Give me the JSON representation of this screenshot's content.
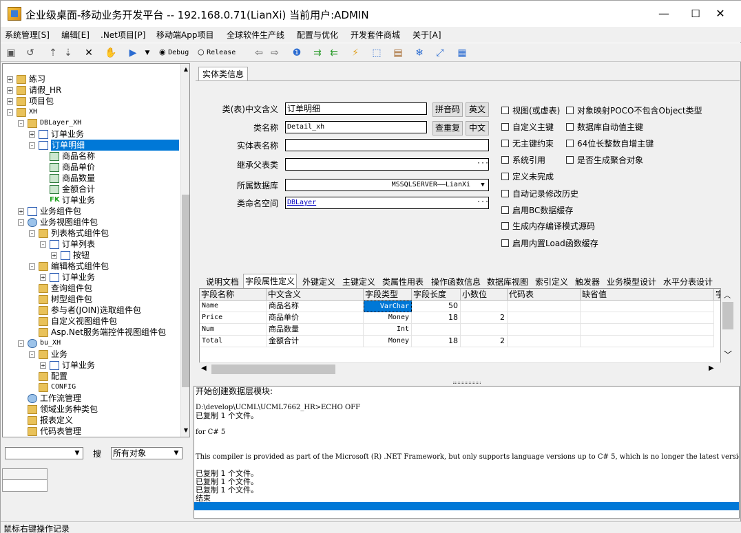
{
  "window": {
    "title": "企业级桌面-移动业务开发平台 -- 192.168.0.71(LianXi) 当前用户:ADMIN",
    "minimize": "—",
    "maximize": "☐",
    "close": "✕"
  },
  "menu": [
    "系统管理[S]",
    "编辑[E]",
    ".Net项目[P]",
    "移动端App项目",
    "全球软件生产线",
    "配置与优化",
    "开发套件商城",
    "关于[A]"
  ],
  "toolbar": {
    "debug_label": "Debug",
    "release_label": "Release",
    "mode": "Debug"
  },
  "tree": [
    {
      "label": "练习",
      "icon": "user-folder-icon",
      "exp": "+"
    },
    {
      "label": "请假_HR",
      "icon": "user-folder-icon",
      "exp": "+"
    },
    {
      "label": "项目包",
      "icon": "folder-icon",
      "exp": "+"
    },
    {
      "label": "XH",
      "icon": "user-folder-icon",
      "exp": "-"
    },
    {
      "label": "DBLayer_XH",
      "icon": "database-icon",
      "exp": "-"
    },
    {
      "label": "订单业务",
      "icon": "table-icon",
      "exp": "+"
    },
    {
      "label": "订单明细",
      "icon": "table-icon",
      "exp": "-",
      "selected": true
    },
    {
      "label": "商品名称",
      "icon": "field-icon"
    },
    {
      "label": "商品单价",
      "icon": "field-icon"
    },
    {
      "label": "商品数量",
      "icon": "field-icon"
    },
    {
      "label": "金额合计",
      "icon": "field-icon"
    },
    {
      "label": "订单业务",
      "icon": "fk-icon",
      "fk": "FK"
    },
    {
      "label": "业务组件包",
      "icon": "component-icon",
      "exp": "+"
    },
    {
      "label": "业务视图组件包",
      "icon": "view-component-icon",
      "exp": "-"
    },
    {
      "label": "列表格式组件包",
      "icon": "folder-icon",
      "exp": "-"
    },
    {
      "label": "订单列表",
      "icon": "list-icon",
      "exp": "-"
    },
    {
      "label": "按钮",
      "icon": "button-icon",
      "exp": "+"
    },
    {
      "label": "编辑格式组件包",
      "icon": "folder-icon",
      "exp": "-"
    },
    {
      "label": "订单业务",
      "icon": "edit-form-icon",
      "exp": "+"
    },
    {
      "label": "查询组件包",
      "icon": "folder-icon"
    },
    {
      "label": "树型组件包",
      "icon": "folder-icon"
    },
    {
      "label": "参与者(JOIN)选取组件包",
      "icon": "folder-icon"
    },
    {
      "label": "自定义视图组件包",
      "icon": "folder-icon"
    },
    {
      "label": "Asp.Net服务端控件视图组件包",
      "icon": "folder-icon"
    },
    {
      "label": "bu_XH",
      "icon": "bu-icon",
      "exp": "-"
    },
    {
      "label": "业务",
      "icon": "folder-icon",
      "exp": "-"
    },
    {
      "label": "订单业务",
      "icon": "doc-icon",
      "exp": "+"
    },
    {
      "label": "配置",
      "icon": "folder-icon"
    },
    {
      "label": "CONFIG",
      "icon": "folder-icon"
    },
    {
      "label": "工作流管理",
      "icon": "workflow-icon"
    },
    {
      "label": "领域业务种类包",
      "icon": "domain-icon"
    },
    {
      "label": "报表定义",
      "icon": "folder-icon"
    },
    {
      "label": "代码表管理",
      "icon": "folder-icon"
    }
  ],
  "left_bottom": {
    "search_label": "搜",
    "object_filter": "所有对象",
    "filter_value": ""
  },
  "entity_tab": "实体类信息",
  "form": {
    "cn_name_label": "类(表)中文含义",
    "cn_name_value": "订单明细",
    "class_name_label": "类名称",
    "class_name_value": "Detail_xh",
    "entity_table_label": "实体表名称",
    "entity_table_value": "",
    "parent_label": "继承父表类",
    "parent_value": "",
    "database_label": "所属数据库",
    "database_value": "MSSQLSERVER——LianXi",
    "namespace_label": "类命名空间",
    "namespace_value": "DBLayer",
    "pinyin_btn": "拼音码",
    "english_btn": "英文",
    "check_dup_btn": "查重复",
    "chinese_btn": "中文",
    "ellipsis": "···"
  },
  "checks_left": [
    "视图(或虚表)",
    "自定义主键",
    "无主键约束",
    "系统引用",
    "定义未完成",
    "自动记录修改历史",
    "启用BC数据缓存",
    "生成内存编译模式源码",
    "启用内置Load函数缓存"
  ],
  "checks_right": [
    "对象映射POCO不包含Object类型",
    "数据库自动值主键",
    "64位长整数自增主键",
    "是否生成聚合对象"
  ],
  "field_tabs": [
    "说明文档",
    "字段属性定义",
    "外键定义",
    "主键定义",
    "类属性用表",
    "操作函数信息",
    "数据库视图",
    "索引定义",
    "触发器",
    "业务模型设计",
    "水平分表设计"
  ],
  "active_field_tab": "字段属性定义",
  "grid": {
    "columns": [
      "字段名称",
      "中文含义",
      "字段类型",
      "字段长度",
      "小数位",
      "代码表",
      "缺省值",
      "字"
    ],
    "rows": [
      {
        "name": "Name",
        "cn": "商品名称",
        "type": "VarChar",
        "len": "50",
        "dec": "",
        "code": "",
        "def": ""
      },
      {
        "name": "Price",
        "cn": "商品单价",
        "type": "Money",
        "len": "18",
        "dec": "2",
        "code": "",
        "def": ""
      },
      {
        "name": "Num",
        "cn": "商品数量",
        "type": "Int",
        "len": "",
        "dec": "",
        "code": "",
        "def": ""
      },
      {
        "name": "Total",
        "cn": "金额合计",
        "type": "Money",
        "len": "18",
        "dec": "2",
        "code": "",
        "def": ""
      }
    ]
  },
  "console": [
    "开始创建数据层模块:",
    "",
    "D:\\develop\\UCML\\UCML7662_HR>ECHO OFF",
    "已复制         1 个文件。",
    "",
    "for C# 5",
    "",
    "",
    "This compiler is provided as part of the Microsoft (R) .NET Framework, but only supports language versions up to C# 5, which is no longer the latest version.",
    "",
    "已复制         1 个文件。",
    "已复制         1 个文件。",
    "已复制         1 个文件。",
    "结束"
  ],
  "status": "鼠标右键操作记录"
}
